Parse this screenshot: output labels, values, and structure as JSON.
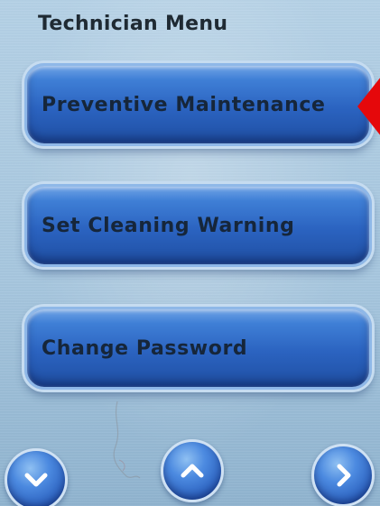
{
  "header": {
    "title": "Technician Menu"
  },
  "menu": {
    "items": [
      {
        "label": "Preventive Maintenance"
      },
      {
        "label": "Set Cleaning Warning"
      },
      {
        "label": "Change Password"
      }
    ]
  },
  "navigation": {
    "down_icon": "chevron-down-icon",
    "up_icon": "chevron-up-icon",
    "next_icon": "chevron-right-icon"
  },
  "colors": {
    "button_blue": "#2b63c0",
    "background": "#a6c6de",
    "pointer_red": "#e5080b",
    "text_dark": "#16263a"
  }
}
